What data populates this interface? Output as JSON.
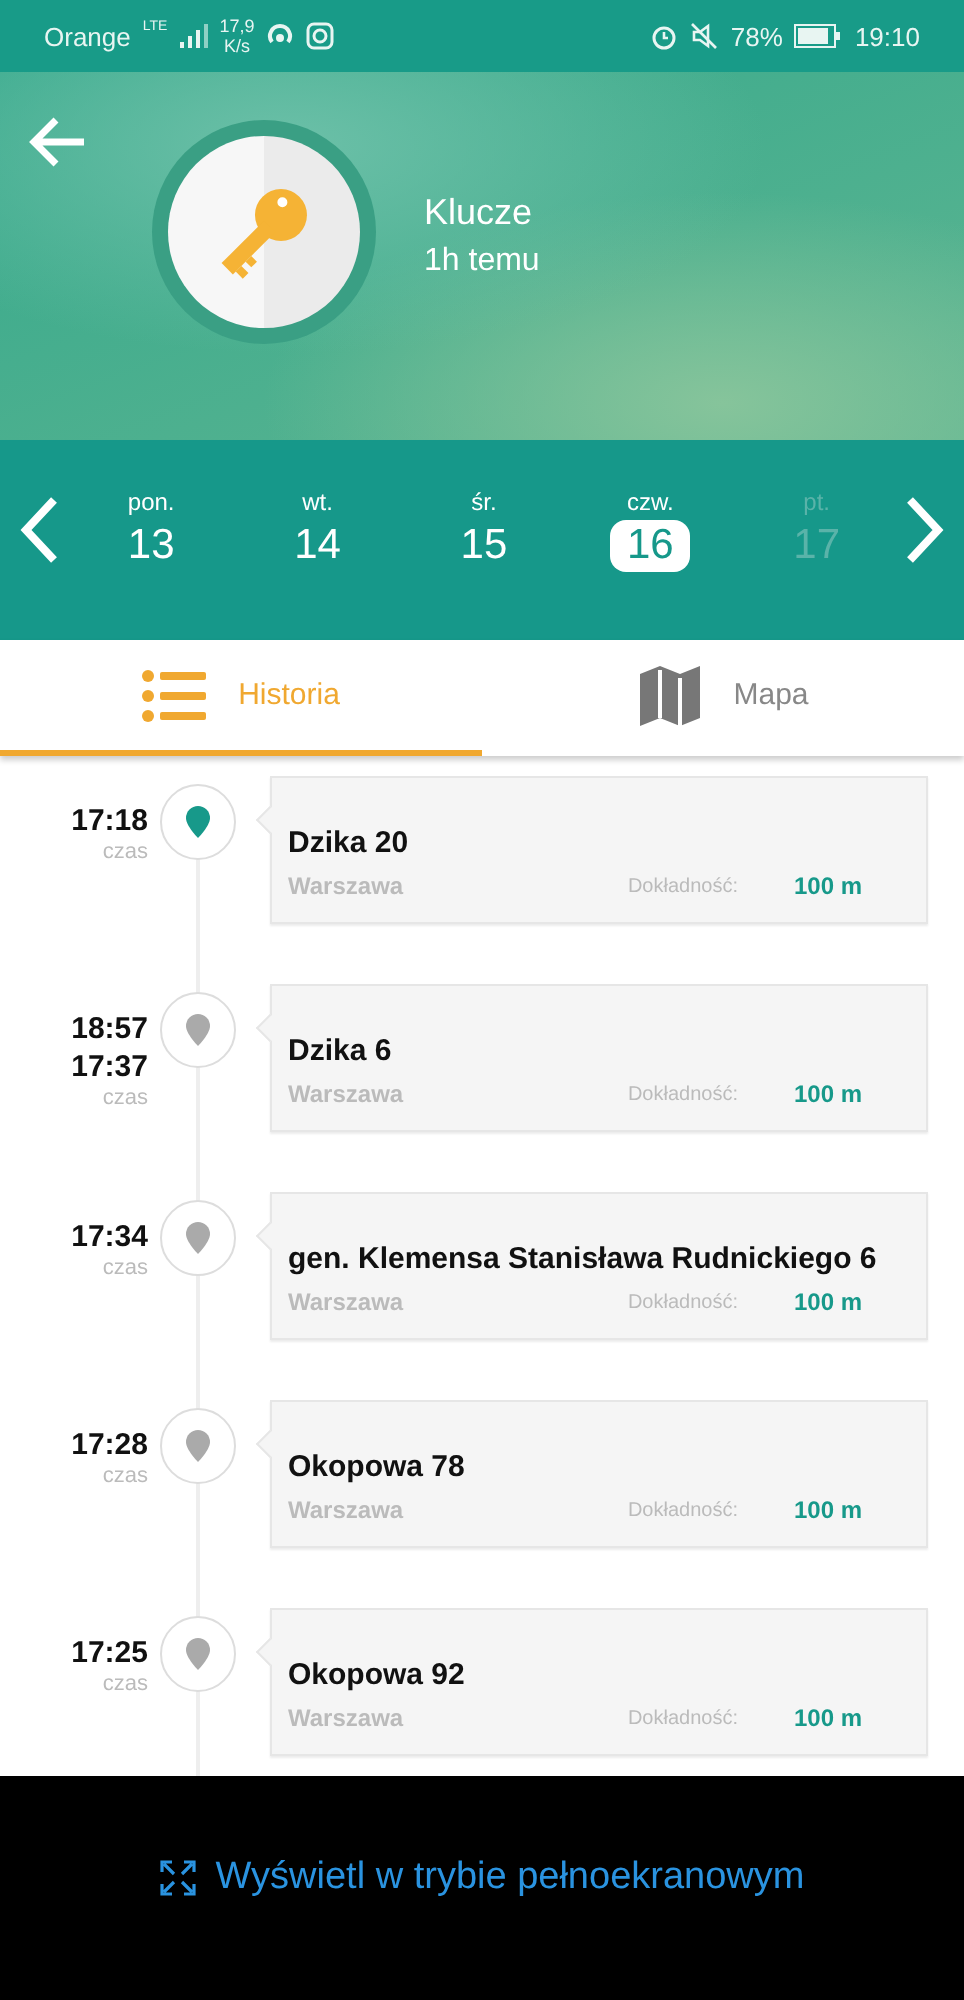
{
  "status_bar": {
    "carrier": "Orange",
    "network": "LTE",
    "speed_value": "17,9",
    "speed_unit": "K/s",
    "battery": "78%",
    "time": "19:10"
  },
  "header": {
    "title": "Klucze",
    "subtitle": "1h  temu"
  },
  "days": [
    {
      "name": "pon.",
      "number": "13",
      "selected": false,
      "disabled": false
    },
    {
      "name": "wt.",
      "number": "14",
      "selected": false,
      "disabled": false
    },
    {
      "name": "śr.",
      "number": "15",
      "selected": false,
      "disabled": false
    },
    {
      "name": "czw.",
      "number": "16",
      "selected": true,
      "disabled": false
    },
    {
      "name": "pt.",
      "number": "17",
      "selected": false,
      "disabled": true
    }
  ],
  "tabs": [
    {
      "label": "Historia",
      "kind": "list",
      "selected": true
    },
    {
      "label": "Mapa",
      "kind": "map",
      "selected": false
    }
  ],
  "entries": [
    {
      "times": [
        "17:18"
      ],
      "time_label": "czas",
      "selected": true,
      "address": "Dzika 20",
      "city": "Warszawa",
      "accuracy_label": "Dokładność:",
      "accuracy": "100 m"
    },
    {
      "times": [
        "18:57",
        "17:37"
      ],
      "time_label": "czas",
      "selected": false,
      "address": "Dzika 6",
      "city": "Warszawa",
      "accuracy_label": "Dokładność:",
      "accuracy": "100 m"
    },
    {
      "times": [
        "17:34"
      ],
      "time_label": "czas",
      "selected": false,
      "address": "gen. Klemensa Stanisława Rudnickiego 6",
      "city": "Warszawa",
      "accuracy_label": "Dokładność:",
      "accuracy": "100 m"
    },
    {
      "times": [
        "17:28"
      ],
      "time_label": "czas",
      "selected": false,
      "address": "Okopowa 78",
      "city": "Warszawa",
      "accuracy_label": "Dokładność:",
      "accuracy": "100 m"
    },
    {
      "times": [
        "17:25"
      ],
      "time_label": "czas",
      "selected": false,
      "address": "Okopowa 92",
      "city": "Warszawa",
      "accuracy_label": "Dokładność:",
      "accuracy": "100 m"
    }
  ],
  "fullscreen_link": "Wyświetl w trybie pełnoekranowym"
}
